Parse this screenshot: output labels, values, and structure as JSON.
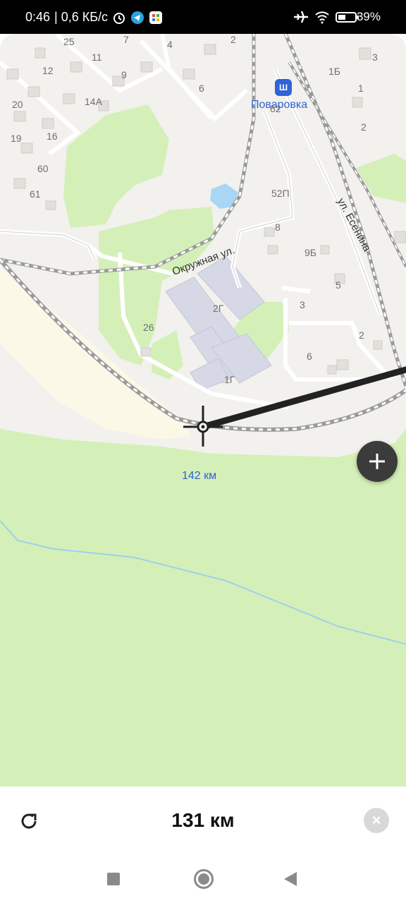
{
  "status_bar": {
    "time": "0:46",
    "speed": "| 0,6 КБ/с",
    "battery": "39%",
    "icons": [
      "alarm-icon",
      "telegram-icon",
      "app-icon",
      "airplane-icon",
      "wifi-icon",
      "battery-icon"
    ]
  },
  "map": {
    "station": "Поваровка",
    "street_esenina": "ул. Есенина",
    "street_okruzhnaya": "Окружная ул.",
    "km_marker": "142 км",
    "house_numbers": [
      "25",
      "11",
      "7",
      "4",
      "2",
      "12",
      "9",
      "6",
      "14А",
      "20",
      "16",
      "19",
      "60",
      "61",
      "62",
      "52П",
      "8",
      "9Б",
      "5",
      "3",
      "2Г",
      "26",
      "1Г",
      "6",
      "2",
      "3",
      "1Б",
      "1",
      "2"
    ]
  },
  "controls": {
    "zoom_in_icon": "plus-icon"
  },
  "bottom": {
    "distance": "131 км",
    "reset_icon": "refresh-icon",
    "close_icon": "close-icon",
    "close_label": "×"
  },
  "nav": {
    "icons": [
      "recents-icon",
      "home-icon",
      "back-icon"
    ]
  },
  "colors": {
    "forest": "#d4f0b8",
    "station_blue": "#2f63d6",
    "route": "#222222",
    "button_dark": "#3b3b3b"
  }
}
